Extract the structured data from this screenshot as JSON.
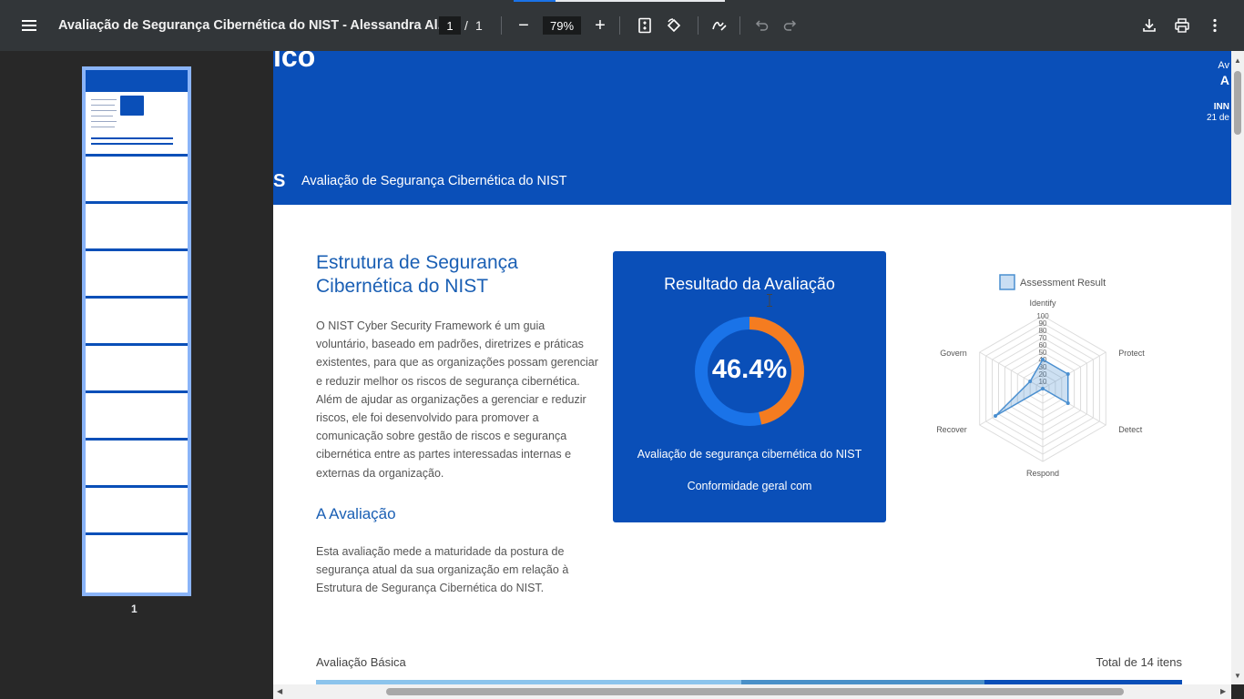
{
  "toolbar": {
    "title": "Avaliação de Segurança Cibernética do NIST - Alessandra Al...",
    "page_current": "1",
    "page_separator": "/",
    "page_total": "1",
    "zoom": "79%",
    "zoom_minus": "−",
    "zoom_plus": "+"
  },
  "sidebar": {
    "thumbnail_page_number": "1"
  },
  "document": {
    "hero": {
      "logo_fragment": "ico",
      "right_line1": "Av",
      "right_line2": "A",
      "right_line3": "INN",
      "right_line4": "21 de",
      "sub_logo": "S",
      "subtitle": "Avaliação de Segurança Cibernética do NIST"
    },
    "section_title": "Estrutura de Segurança Cibernética do NIST",
    "paragraph": "O NIST Cyber Security Framework é um guia voluntário, baseado em padrões, diretrizes e práticas existentes, para que as organizações possam gerenciar e reduzir melhor os riscos de segurança cibernética. Além de ajudar as organizações a gerenciar e reduzir riscos, ele foi desenvolvido para promover a comunicação sobre gestão de riscos e segurança cibernética entre as partes interessadas internas e externas da organização.",
    "subsection_title": "A Avaliação",
    "paragraph2": "Esta avaliação mede a maturidade da postura de segurança atual da sua organização em relação à Estrutura de Segurança Cibernética do NIST.",
    "result_card": {
      "title": "Resultado da Avaliação",
      "percentage": "46.4%",
      "percentage_value": 46.4,
      "description": "Avaliação de segurança cibernética do NIST",
      "compliance": "Conformidade geral com",
      "ring_color": "#1a73e8",
      "accent_color": "#f57c20"
    },
    "footer": {
      "left": "Avaliação Básica",
      "right": "Total de 14 itens"
    }
  },
  "chart_data": {
    "type": "radar",
    "series": [
      {
        "name": "Assessment Result",
        "values": [
          40,
          40,
          40,
          0,
          75,
          20
        ]
      }
    ],
    "categories": [
      "Identify",
      "Protect",
      "Detect",
      "Respond",
      "Recover",
      "Govern"
    ],
    "ticks": [
      "10",
      "20",
      "30",
      "40",
      "50",
      "60",
      "70",
      "80",
      "90",
      "100"
    ],
    "range": [
      0,
      100
    ],
    "legend": "top"
  },
  "colors": {
    "brand_blue": "#0a4fb8",
    "heading_blue": "#1a5fb4",
    "toolbar_bg": "#323639"
  }
}
